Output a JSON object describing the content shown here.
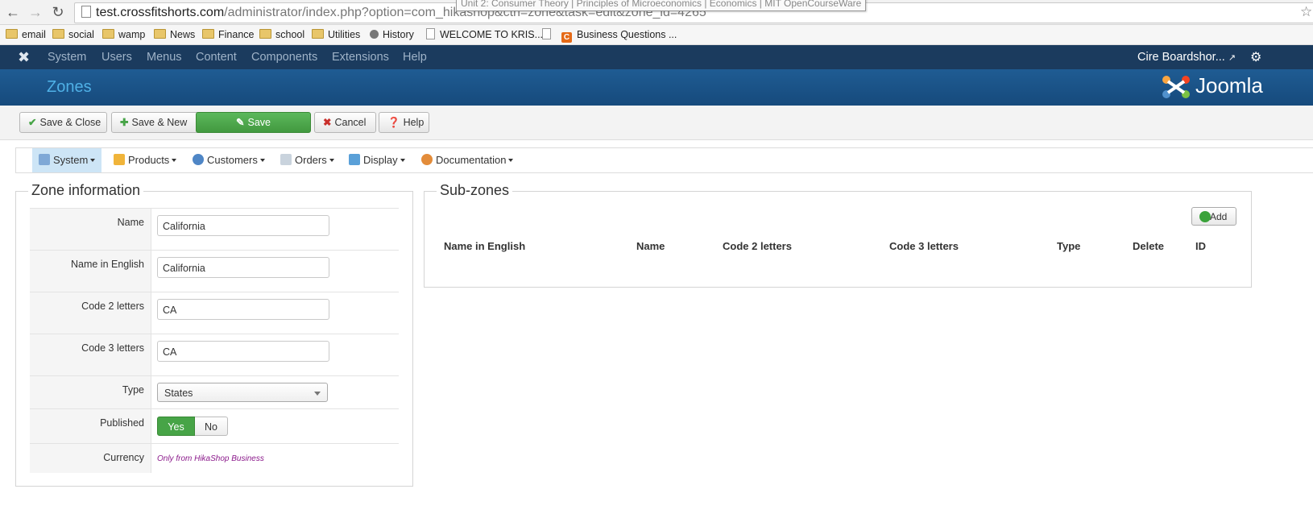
{
  "browser": {
    "url_host": "test.crossfitshorts.com",
    "url_path": "/administrator/index.php?option=com_hikashop&ctrl=zone&task=edit&zone_id=4265",
    "tooltip": "Unit 2: Consumer Theory | Principles of Microeconomics | Economics | MIT OpenCourseWare",
    "bookmarks": [
      "email",
      "social",
      "wamp",
      "News",
      "Finance",
      "school",
      "Utilities",
      "History",
      "WELCOME TO KRIS...",
      "Business Questions ..."
    ]
  },
  "admin_nav": {
    "menu": [
      "System",
      "Users",
      "Menus",
      "Content",
      "Components",
      "Extensions",
      "Help"
    ],
    "user": "Cire Boardshor..."
  },
  "header": {
    "title": "Zones",
    "brand": "Joomla"
  },
  "toolbar": {
    "save_close": "Save & Close",
    "save_new": "Save & New",
    "save": "Save",
    "cancel": "Cancel",
    "help": "Help"
  },
  "hika_menu": [
    "System",
    "Products",
    "Customers",
    "Orders",
    "Display",
    "Documentation"
  ],
  "zone_info": {
    "legend": "Zone information",
    "name_label": "Name",
    "name_value": "California",
    "name_en_label": "Name in English",
    "name_en_value": "California",
    "code2_label": "Code 2 letters",
    "code2_value": "CA",
    "code3_label": "Code 3 letters",
    "code3_value": "CA",
    "type_label": "Type",
    "type_value": "States",
    "published_label": "Published",
    "published_yes": "Yes",
    "published_no": "No",
    "currency_label": "Currency",
    "currency_note": "Only from HikaShop Business"
  },
  "subzones": {
    "legend": "Sub-zones",
    "add": "Add",
    "columns": [
      "Name in English",
      "Name",
      "Code 2 letters",
      "Code 3 letters",
      "Type",
      "Delete",
      "ID"
    ]
  },
  "colors": {
    "nav_bg": "#1b3b5e",
    "header_bg": "#1f5c93",
    "save_green": "#5cb85c",
    "title_blue": "#4fb0e6"
  }
}
